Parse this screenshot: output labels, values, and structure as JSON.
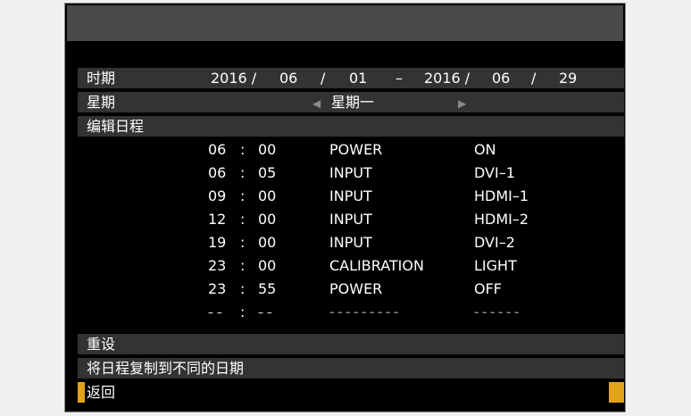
{
  "header": {
    "title": ""
  },
  "period": {
    "label": "时期",
    "start_year": "2016 /",
    "start_month": "06",
    "sep1": "/",
    "start_day": "01",
    "dash": "–",
    "end_year": "2016 /",
    "end_month": "06",
    "sep2": "/",
    "end_day": "29"
  },
  "weekday": {
    "label": "星期",
    "prev_icon": "◀",
    "value": "星期一",
    "next_icon": "▶"
  },
  "edit_schedule": {
    "label": "编辑日程"
  },
  "schedule": [
    {
      "hour": "06",
      "colon": ":",
      "minute": "00",
      "command": "POWER",
      "value": "ON"
    },
    {
      "hour": "06",
      "colon": ":",
      "minute": "05",
      "command": "INPUT",
      "value": "DVI–1"
    },
    {
      "hour": "09",
      "colon": ":",
      "minute": "00",
      "command": "INPUT",
      "value": "HDMI–1"
    },
    {
      "hour": "12",
      "colon": ":",
      "minute": "00",
      "command": "INPUT",
      "value": "HDMI–2"
    },
    {
      "hour": "19",
      "colon": ":",
      "minute": "00",
      "command": "INPUT",
      "value": "DVI–2"
    },
    {
      "hour": "23",
      "colon": ":",
      "minute": "00",
      "command": "CALIBRATION",
      "value": "LIGHT"
    },
    {
      "hour": "23",
      "colon": ":",
      "minute": "55",
      "command": "POWER",
      "value": "OFF"
    },
    {
      "hour": "– –",
      "colon": ":",
      "minute": "– –",
      "command": "– – – – – – – – –",
      "value": "– – – – – –"
    }
  ],
  "menu": {
    "reset": "重设",
    "copy_schedule": "将日程复制到不同的日期",
    "back": "返回"
  },
  "colors": {
    "background": "#000000",
    "row_highlight": "#333333",
    "selected": "#e3a319",
    "text": "#ffffff"
  }
}
